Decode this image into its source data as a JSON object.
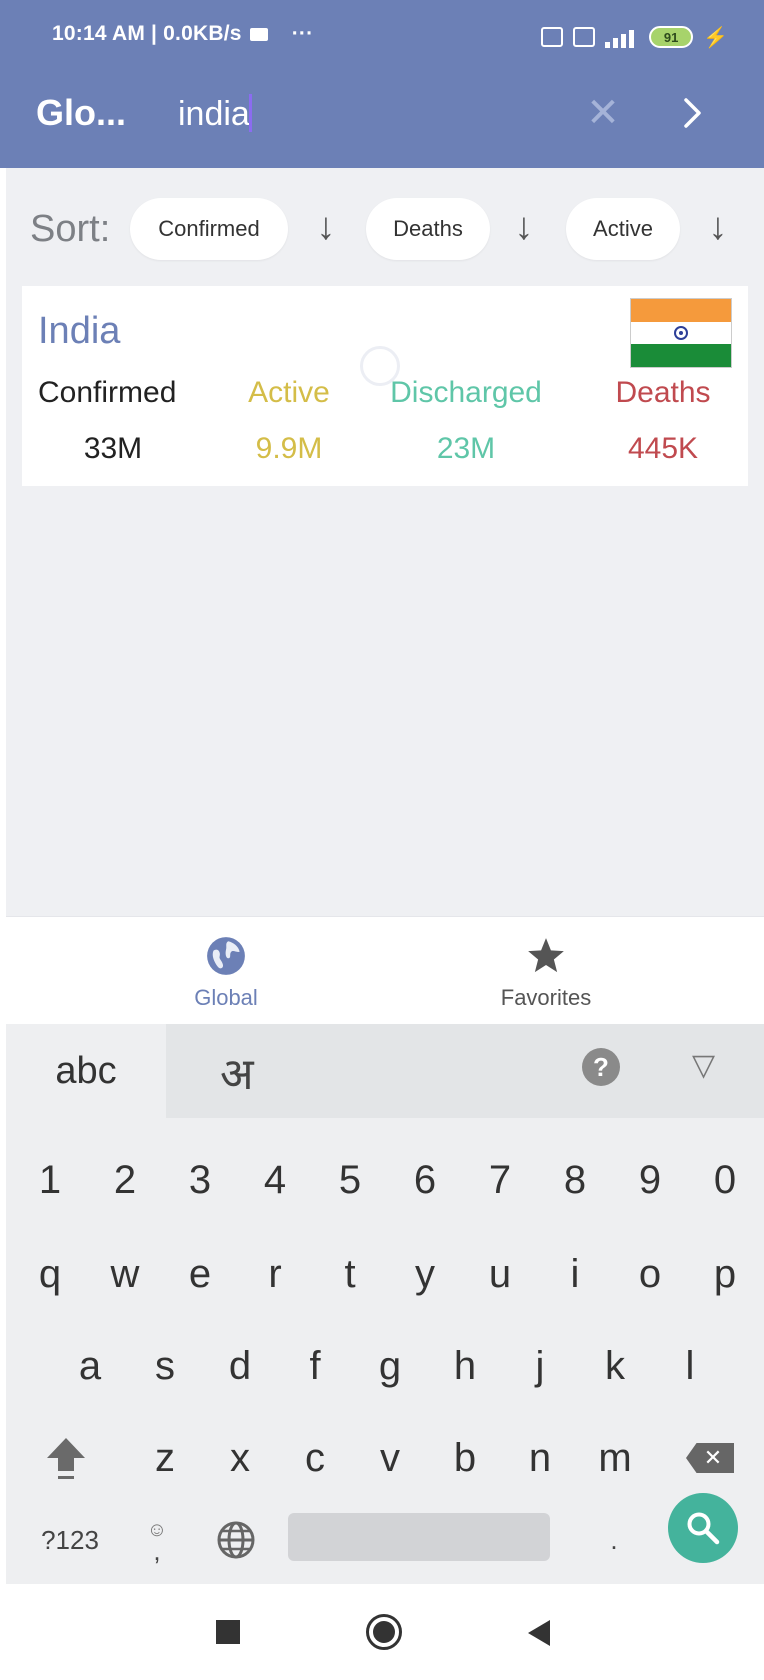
{
  "statusbar": {
    "time_text": "10:14 AM | 0.0KB/s",
    "more_dots": "···",
    "battery_level": "91"
  },
  "appbar": {
    "title": "Glo...",
    "search_value": "india",
    "clear_glyph": "✕",
    "next_glyph": "›"
  },
  "sort": {
    "label": "Sort:",
    "chips": [
      {
        "label": "Confirmed",
        "arrow": "↓"
      },
      {
        "label": "Deaths",
        "arrow": "↓"
      },
      {
        "label": "Active",
        "arrow": "↓"
      }
    ]
  },
  "result": {
    "country": "India",
    "flag": "india-flag",
    "stats": [
      {
        "label": "Confirmed",
        "value": "33M",
        "color": "#222222"
      },
      {
        "label": "Active",
        "value": "9.9M",
        "color": "#d4bd48"
      },
      {
        "label": "Discharged",
        "value": "23M",
        "color": "#5fc6a8"
      },
      {
        "label": "Deaths",
        "value": "445K",
        "color": "#c04a4f"
      }
    ]
  },
  "bottom_nav": {
    "items": [
      {
        "label": "Global",
        "icon": "globe-icon",
        "active": true,
        "color": "#6c80b6"
      },
      {
        "label": "Favorites",
        "icon": "star-icon",
        "active": false,
        "color": "#555555"
      }
    ]
  },
  "keyboard": {
    "tabs": {
      "latin": "abc",
      "devanagari": "अ"
    },
    "help_glyph": "?",
    "hide_glyph": "▽",
    "rows": [
      [
        "1",
        "2",
        "3",
        "4",
        "5",
        "6",
        "7",
        "8",
        "9",
        "0"
      ],
      [
        "q",
        "w",
        "e",
        "r",
        "t",
        "y",
        "u",
        "i",
        "o",
        "p"
      ],
      [
        "a",
        "s",
        "d",
        "f",
        "g",
        "h",
        "j",
        "k",
        "l"
      ],
      [
        "z",
        "x",
        "c",
        "v",
        "b",
        "n",
        "m"
      ]
    ],
    "symbols_key": "?123",
    "comma_key": ",",
    "period_key": "."
  },
  "colors": {
    "app_bar": "#6c80b6",
    "content_bg": "#eff0f3",
    "keyboard_bg": "#eeeff1",
    "search_key": "#44b39c"
  }
}
